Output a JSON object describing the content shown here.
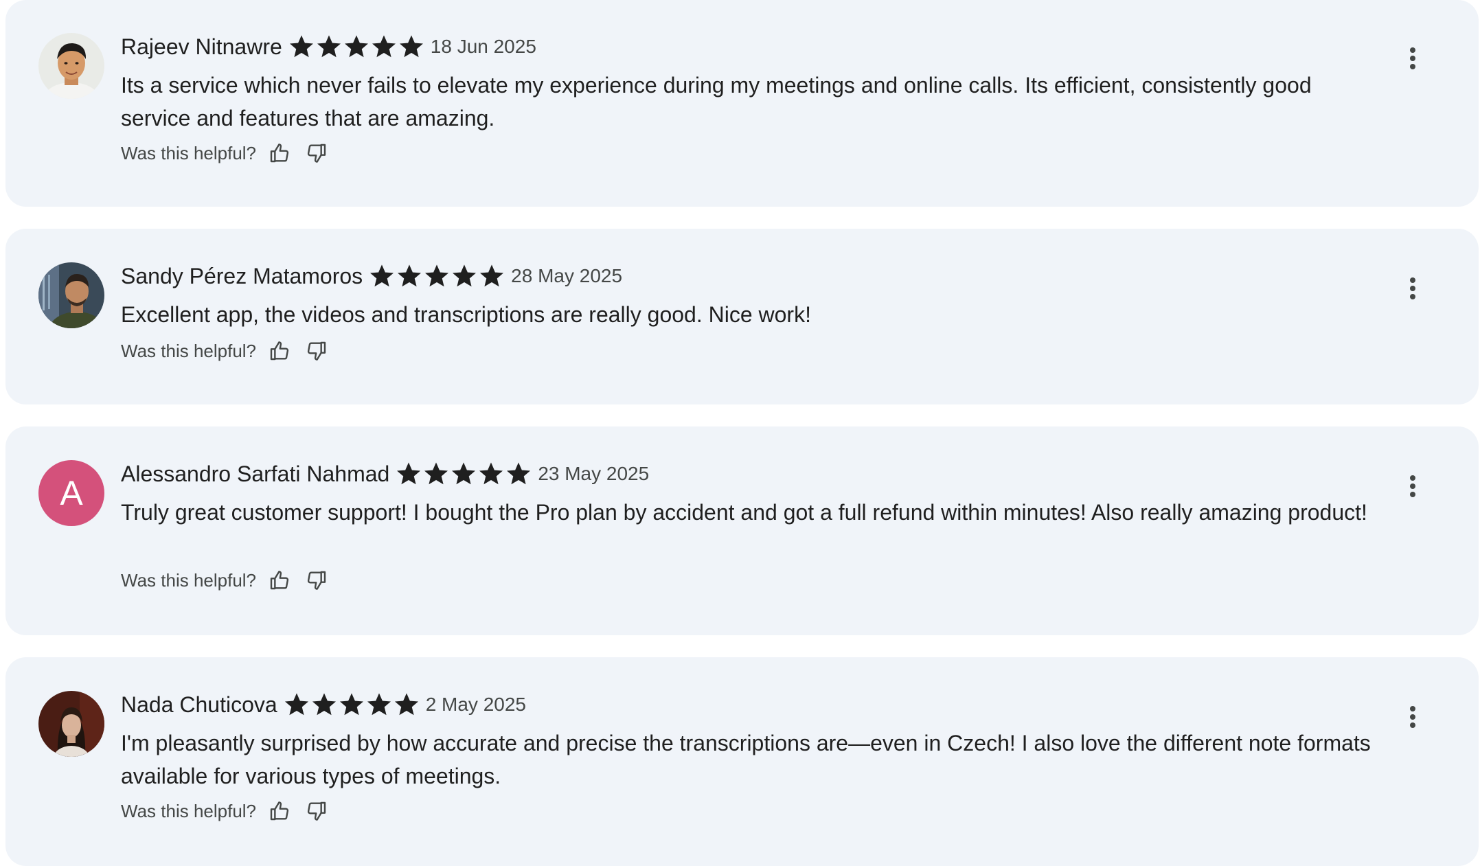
{
  "icons": {
    "star": "star-icon",
    "thumb_up": "thumb-up-icon",
    "thumb_down": "thumb-down-icon",
    "more": "more-vert-icon"
  },
  "colors": {
    "card_background": "#f0f4f9",
    "star": "#1f1f1f",
    "letter_avatar": "#d4517b"
  },
  "reviews": [
    {
      "author": "Rajeev Nitnawre",
      "rating": 5,
      "date": "18 Jun 2025",
      "text": "Its a service which never fails to elevate my experience during my meetings and online calls. Its efficient, consistently good service and features that are amazing.",
      "helpful_label": "Was this helpful?"
    },
    {
      "author": "Sandy Pérez Matamoros",
      "rating": 5,
      "date": "28 May 2025",
      "text": "Excellent app, the videos and transcriptions are really good. Nice work!",
      "helpful_label": "Was this helpful?"
    },
    {
      "author": "Alessandro Sarfati Nahmad",
      "avatar_letter": "A",
      "rating": 5,
      "date": "23 May 2025",
      "text": "Truly great customer support! I bought the Pro plan by accident and got a full refund within minutes! Also really amazing product!",
      "helpful_label": "Was this helpful?"
    },
    {
      "author": "Nada Chuticova",
      "rating": 5,
      "date": "2 May 2025",
      "text": "I'm pleasantly surprised by how accurate and precise the transcriptions are—even in Czech! I also love the different note formats available for various types of meetings.",
      "helpful_label": "Was this helpful?"
    }
  ]
}
